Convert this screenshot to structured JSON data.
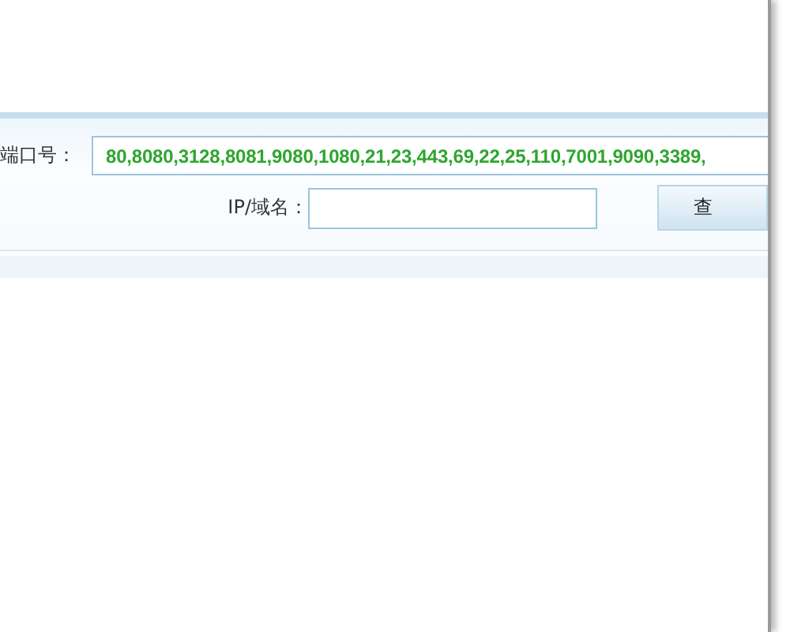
{
  "port_field": {
    "label": "端口号：",
    "value": "80,8080,3128,8081,9080,1080,21,23,443,69,22,25,110,7001,9090,3389,"
  },
  "host_field": {
    "label": "IP/域名："
  },
  "query_button": {
    "label": "查"
  }
}
